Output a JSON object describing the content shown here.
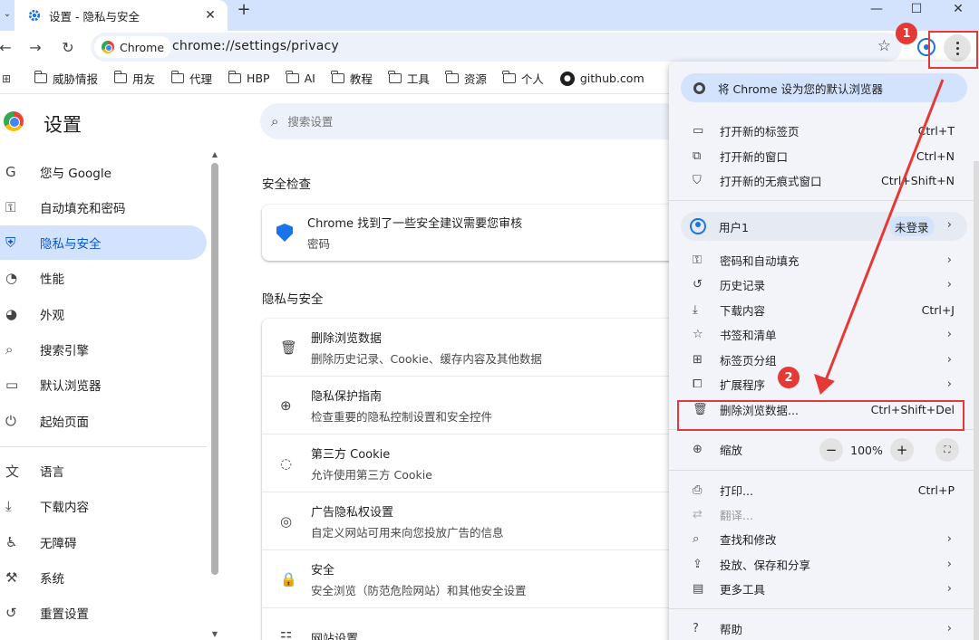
{
  "tab": {
    "title": "设置 - 隐私与安全",
    "close": "✕"
  },
  "window": {
    "new_tab": "+",
    "minimize": "—",
    "maximize": "☐",
    "close": "✕"
  },
  "toolbar": {
    "back": "←",
    "forward": "→",
    "reload": "↻",
    "chip_label": "Chrome",
    "url": "chrome://settings/privacy",
    "star": "☆"
  },
  "bookmarks": [
    "威胁情报",
    "用友",
    "代理",
    "HBP",
    "AI",
    "教程",
    "工具",
    "资源",
    "个人"
  ],
  "bookmark_github": "github.com",
  "settings": {
    "title": "设置",
    "search_placeholder": "搜索设置"
  },
  "sidebar": {
    "items": [
      {
        "icon": "G",
        "label": "您与 Google"
      },
      {
        "icon": "⚿",
        "label": "自动填充和密码"
      },
      {
        "icon": "⛨",
        "label": "隐私与安全"
      },
      {
        "icon": "◔",
        "label": "性能"
      },
      {
        "icon": "◕",
        "label": "外观"
      },
      {
        "icon": "⌕",
        "label": "搜索引擎"
      },
      {
        "icon": "▭",
        "label": "默认浏览器"
      },
      {
        "icon": "⏻",
        "label": "起始页面"
      },
      {
        "icon": "文",
        "label": "语言"
      },
      {
        "icon": "⤓",
        "label": "下载内容"
      },
      {
        "icon": "♿",
        "label": "无障碍"
      },
      {
        "icon": "⚒",
        "label": "系统"
      },
      {
        "icon": "↺",
        "label": "重置设置"
      }
    ]
  },
  "main": {
    "safety_check_title": "安全检查",
    "safety_check": {
      "line1": "Chrome 找到了一些安全建议需要您审核",
      "line2": "密码"
    },
    "privacy_title": "隐私与安全",
    "privacy_rows": [
      {
        "icon": "🗑",
        "title": "删除浏览数据",
        "sub": "删除历史记录、Cookie、缓存内容及其他数据"
      },
      {
        "icon": "⊕",
        "title": "隐私保护指南",
        "sub": "检查重要的隐私控制设置和安全控件"
      },
      {
        "icon": "◌",
        "title": "第三方 Cookie",
        "sub": "允许使用第三方 Cookie"
      },
      {
        "icon": "◎",
        "title": "广告隐私权设置",
        "sub": "自定义网站可用来向您投放广告的信息"
      },
      {
        "icon": "🔒",
        "title": "安全",
        "sub": "安全浏览（防范危险网站）和其他安全设置"
      },
      {
        "icon": "☷",
        "title": "网站设置",
        "sub": ""
      }
    ]
  },
  "menu": {
    "default_browser": "将 Chrome 设为您的默认浏览器",
    "group1": [
      {
        "icon": "▭",
        "label": "打开新的标签页",
        "shortcut": "Ctrl+T"
      },
      {
        "icon": "⧉",
        "label": "打开新的窗口",
        "shortcut": "Ctrl+N"
      },
      {
        "icon": "⛉",
        "label": "打开新的无痕式窗口",
        "shortcut": "Ctrl+Shift+N"
      }
    ],
    "user": {
      "name": "用户1",
      "badge": "未登录",
      "arrow": "›"
    },
    "group2": [
      {
        "icon": "⚿",
        "label": "密码和自动填充",
        "shortcut": "",
        "arrow": "›"
      },
      {
        "icon": "↺",
        "label": "历史记录",
        "shortcut": "",
        "arrow": "›"
      },
      {
        "icon": "⤓",
        "label": "下载内容",
        "shortcut": "Ctrl+J",
        "arrow": ""
      },
      {
        "icon": "☆",
        "label": "书签和清单",
        "shortcut": "",
        "arrow": "›"
      },
      {
        "icon": "⊞",
        "label": "标签页分组",
        "shortcut": "",
        "arrow": "›"
      },
      {
        "icon": "⧠",
        "label": "扩展程序",
        "shortcut": "",
        "arrow": "›"
      },
      {
        "icon": "🗑",
        "label": "删除浏览数据...",
        "shortcut": "Ctrl+Shift+Del",
        "arrow": ""
      }
    ],
    "zoom": {
      "label": "缩放",
      "minus": "−",
      "value": "100%",
      "plus": "+",
      "fullscreen": "⛶"
    },
    "group3": [
      {
        "icon": "⎙",
        "label": "打印...",
        "shortcut": "Ctrl+P",
        "arrow": "",
        "disabled": false
      },
      {
        "icon": "⇄",
        "label": "翻译...",
        "shortcut": "",
        "arrow": "",
        "disabled": true
      },
      {
        "icon": "⌕",
        "label": "查找和修改",
        "shortcut": "",
        "arrow": "›",
        "disabled": false
      },
      {
        "icon": "⇪",
        "label": "投放、保存和分享",
        "shortcut": "",
        "arrow": "›",
        "disabled": false
      },
      {
        "icon": "▤",
        "label": "更多工具",
        "shortcut": "",
        "arrow": "›",
        "disabled": false
      }
    ],
    "help": {
      "icon": "?",
      "label": "帮助",
      "arrow": "›"
    }
  },
  "annotations": {
    "one": "1",
    "two": "2",
    "color": "#e53935"
  },
  "colors": {
    "accent": "#1a73e8",
    "active_bg": "#d3e3fd",
    "menu_bg": "#f2f4fa"
  }
}
